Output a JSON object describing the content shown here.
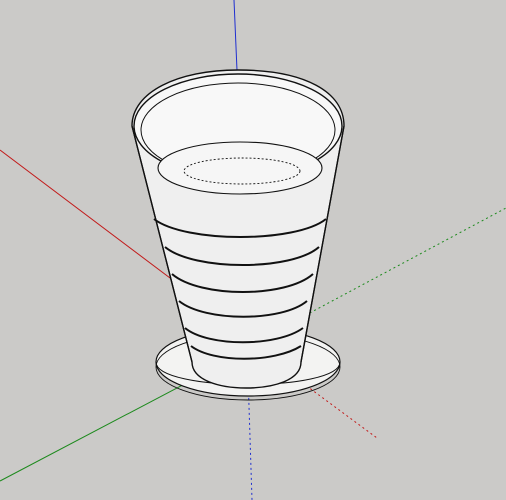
{
  "scene": {
    "background_color": "#cbcac8",
    "model": "tapered-cup-on-saucer",
    "axes": {
      "red": "#c21a1a",
      "green": "#1d8a1d",
      "blue": "#1f2fd0"
    },
    "cup": {
      "fill": "#efefef",
      "stroke": "#111111",
      "band_count": 6
    }
  }
}
